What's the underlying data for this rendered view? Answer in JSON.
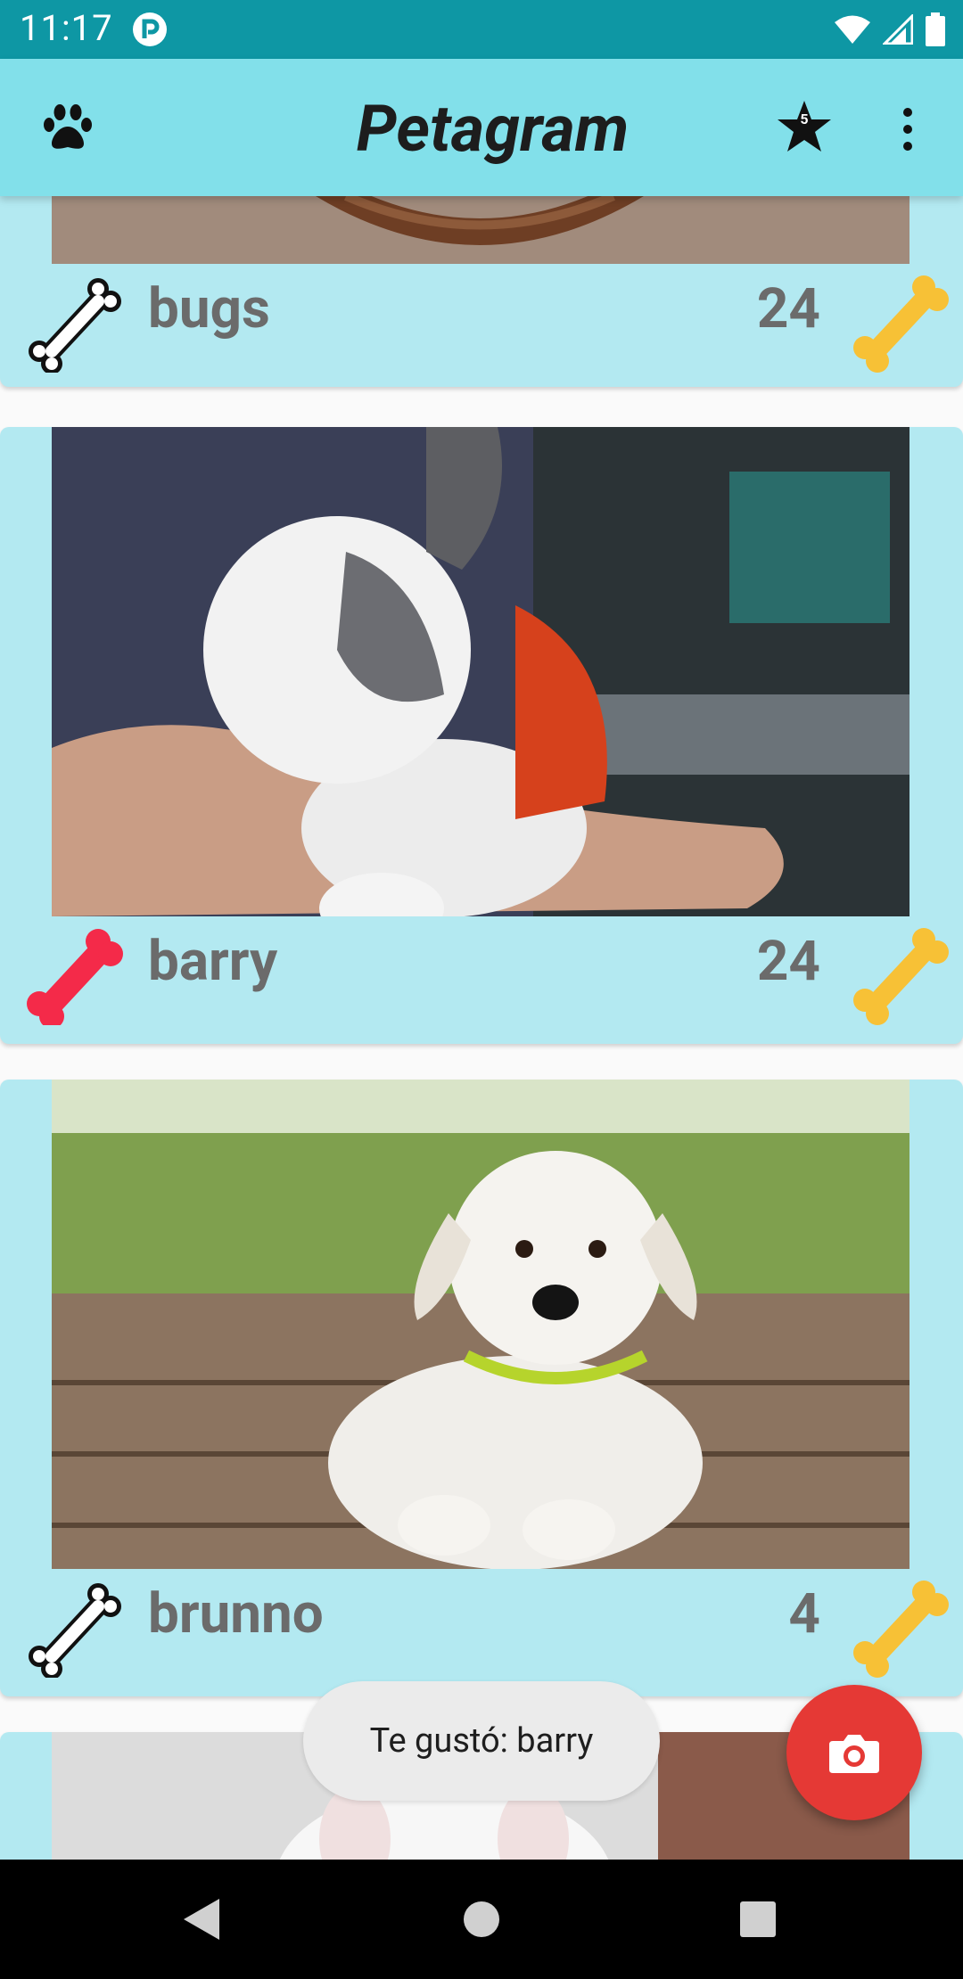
{
  "status_bar": {
    "time": "11:17"
  },
  "app_bar": {
    "title": "Petagram",
    "favorites_badge": "5"
  },
  "pets": [
    {
      "name": "bugs",
      "likes": "24",
      "liked": false
    },
    {
      "name": "barry",
      "likes": "24",
      "liked": true
    },
    {
      "name": "brunno",
      "likes": "4",
      "liked": false
    },
    {
      "name": "",
      "likes": "",
      "liked": false
    }
  ],
  "toast": {
    "message": "Te gustó:  barry"
  },
  "colors": {
    "status_bar": "#0e97a4",
    "app_bar": "#82e0ea",
    "card": "#b3e9f1",
    "liked_bone": "#f42a49",
    "rating_bone": "#f7c136",
    "fab": "#e53935"
  },
  "icons": {
    "app": "paw-icon",
    "favorites": "star-icon",
    "overflow": "more-vert-icon",
    "like": "bone-icon",
    "rating": "bone-icon",
    "fab": "camera-icon"
  }
}
